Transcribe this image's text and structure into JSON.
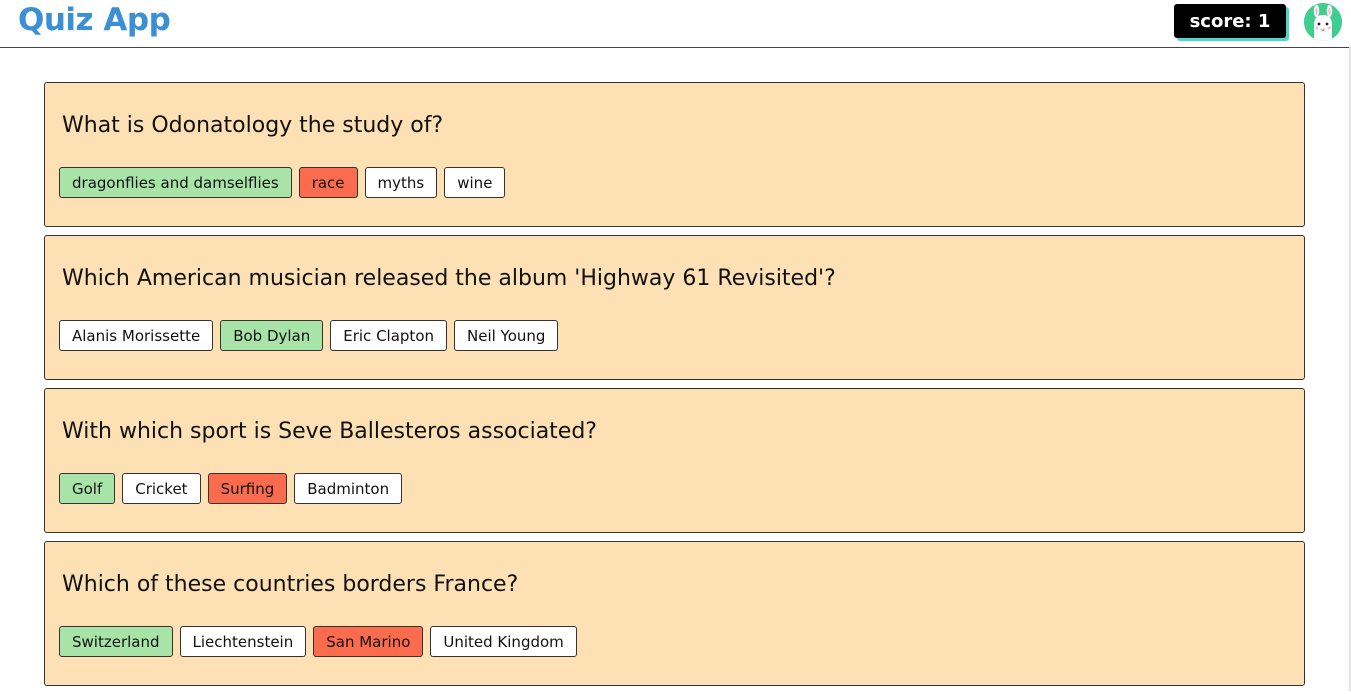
{
  "header": {
    "app_title": "Quiz App",
    "score_label": "score: 1",
    "avatar": "llama-avatar"
  },
  "colors": {
    "title": "#3b8fd4",
    "card_bg": "#fde1b4",
    "correct": "#a8e4a8",
    "wrong": "#fb6b4d",
    "neutral": "#ffffff"
  },
  "questions": [
    {
      "text": "What is Odonatology the study of?",
      "answers": [
        {
          "label": "dragonflies and damselflies",
          "state": "correct"
        },
        {
          "label": "race",
          "state": "wrong"
        },
        {
          "label": "myths",
          "state": "neutral"
        },
        {
          "label": "wine",
          "state": "neutral"
        }
      ]
    },
    {
      "text": "Which American musician released the album 'Highway 61 Revisited'?",
      "answers": [
        {
          "label": "Alanis Morissette",
          "state": "neutral"
        },
        {
          "label": "Bob Dylan",
          "state": "correct"
        },
        {
          "label": "Eric Clapton",
          "state": "neutral"
        },
        {
          "label": "Neil Young",
          "state": "neutral"
        }
      ]
    },
    {
      "text": "With which sport is Seve Ballesteros associated?",
      "answers": [
        {
          "label": "Golf",
          "state": "correct"
        },
        {
          "label": "Cricket",
          "state": "neutral"
        },
        {
          "label": "Surfing",
          "state": "wrong"
        },
        {
          "label": "Badminton",
          "state": "neutral"
        }
      ]
    },
    {
      "text": "Which of these countries borders France?",
      "answers": [
        {
          "label": "Switzerland",
          "state": "correct"
        },
        {
          "label": "Liechtenstein",
          "state": "neutral"
        },
        {
          "label": "San Marino",
          "state": "wrong"
        },
        {
          "label": "United Kingdom",
          "state": "neutral"
        }
      ]
    }
  ]
}
